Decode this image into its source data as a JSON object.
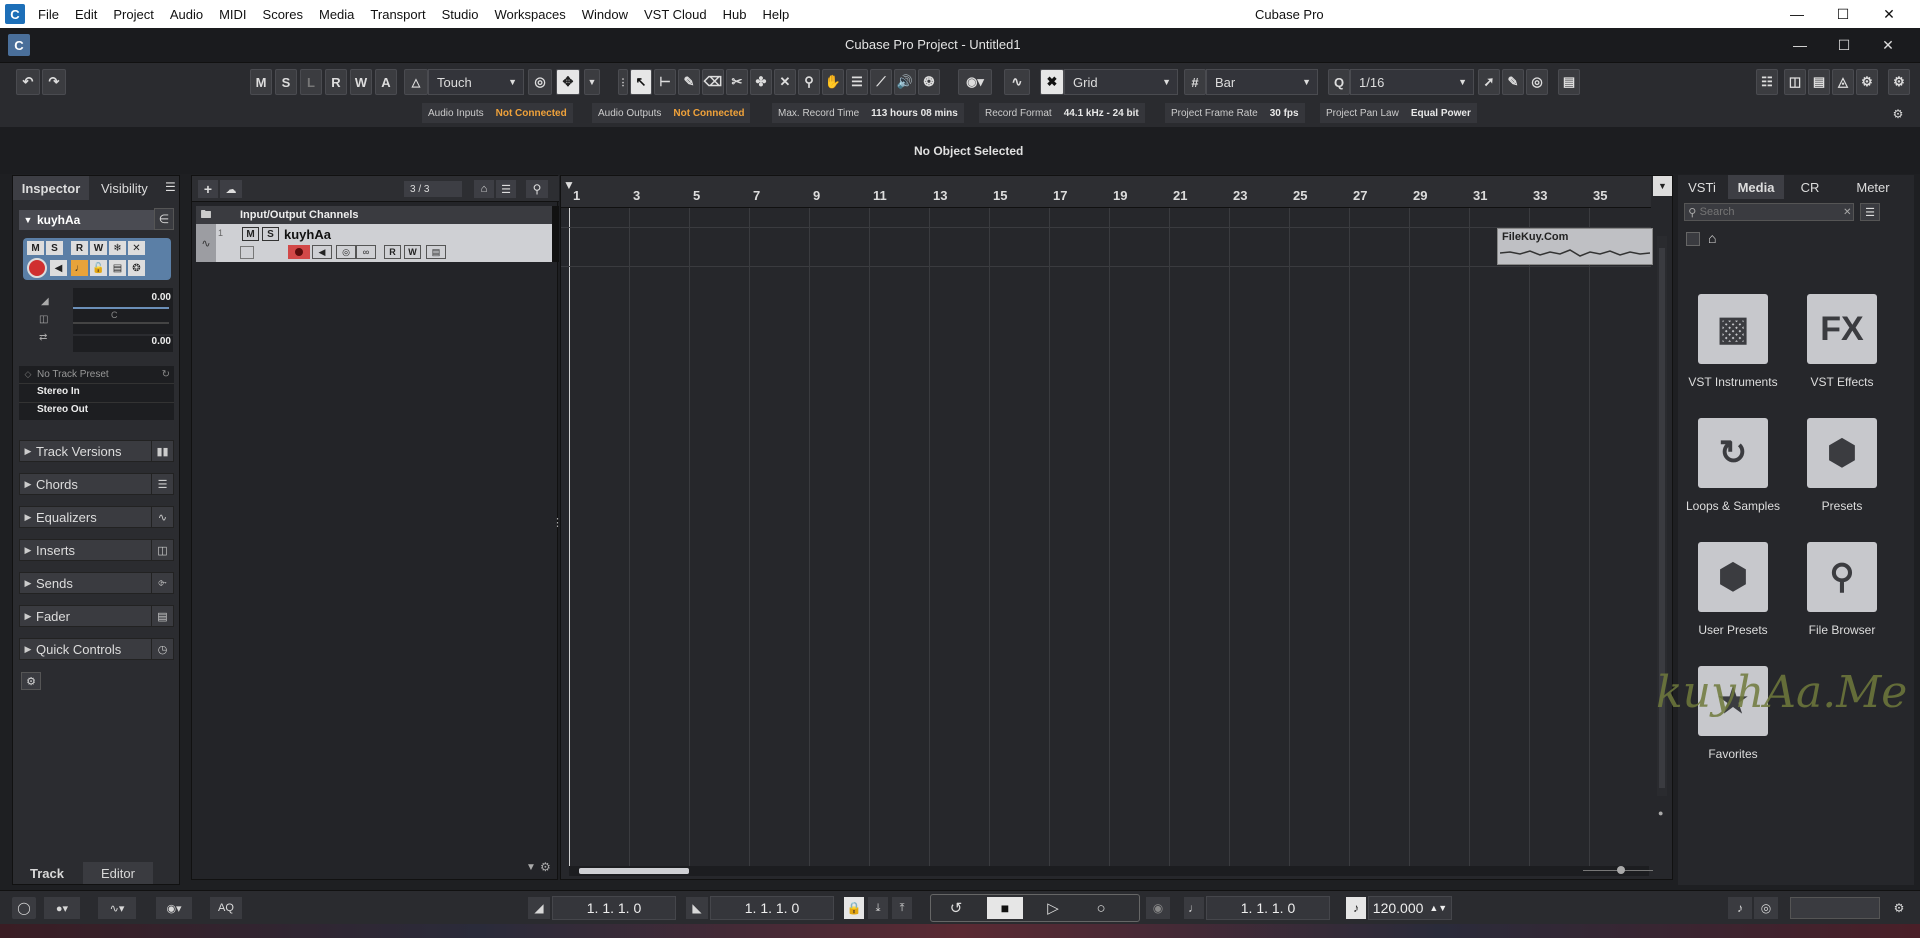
{
  "window": {
    "app_title": "Cubase Pro",
    "menu": [
      "File",
      "Edit",
      "Project",
      "Audio",
      "MIDI",
      "Scores",
      "Media",
      "Transport",
      "Studio",
      "Workspaces",
      "Window",
      "VST Cloud",
      "Hub",
      "Help"
    ],
    "project_title": "Cubase Pro Project - Untitled1"
  },
  "toolbar": {
    "mode_buttons": [
      "M",
      "S",
      "L",
      "R",
      "W",
      "A"
    ],
    "automation_mode": "Touch",
    "snap_type": "Grid",
    "grid": "Bar",
    "quantize": "1/16"
  },
  "status": {
    "audio_inputs_label": "Audio Inputs",
    "audio_inputs_value": "Not Connected",
    "audio_outputs_label": "Audio Outputs",
    "audio_outputs_value": "Not Connected",
    "max_record_label": "Max. Record Time",
    "max_record_value": "113 hours 08 mins",
    "record_format_label": "Record Format",
    "record_format_value": "44.1 kHz - 24 bit",
    "frame_rate_label": "Project Frame Rate",
    "frame_rate_value": "30 fps",
    "pan_law_label": "Project Pan Law",
    "pan_law_value": "Equal Power"
  },
  "info_line": "No Object Selected",
  "inspector": {
    "tab_inspector": "Inspector",
    "tab_visibility": "Visibility",
    "track_name": "kuyhAa",
    "volume": "0.00",
    "pan_label": "C",
    "pan_value": "0.00",
    "track_preset": "No Track Preset",
    "input_routing": "Stereo In",
    "output_routing": "Stereo Out",
    "sections": [
      "Track Versions",
      "Chords",
      "Equalizers",
      "Inserts",
      "Sends",
      "Fader",
      "Quick Controls"
    ],
    "bottom_tab_track": "Track",
    "bottom_tab_editor": "Editor"
  },
  "tracklist": {
    "counter": "3 / 3",
    "folder_name": "Input/Output Channels",
    "track_number": "1",
    "track_name": "kuyhAa"
  },
  "ruler": {
    "bars": [
      "1",
      "3",
      "5",
      "7",
      "9",
      "11",
      "13",
      "15",
      "17",
      "19",
      "21",
      "23",
      "25",
      "27",
      "29",
      "31",
      "33",
      "35"
    ]
  },
  "event_label": "FileKuy.Com",
  "rightzone": {
    "tabs": [
      "VSTi",
      "Media",
      "CR",
      "Meter"
    ],
    "search_placeholder": "Search",
    "tiles": [
      "VST Instruments",
      "VST Effects",
      "Loops & Samples",
      "Presets",
      "User Presets",
      "File Browser",
      "Favorites"
    ]
  },
  "watermark": "kuyhAa.Me",
  "transport": {
    "aq_label": "AQ",
    "left_locator": "1. 1. 1.   0",
    "right_locator": "1. 1. 1.   0",
    "position": "1. 1. 1.   0",
    "tempo": "120.000"
  }
}
